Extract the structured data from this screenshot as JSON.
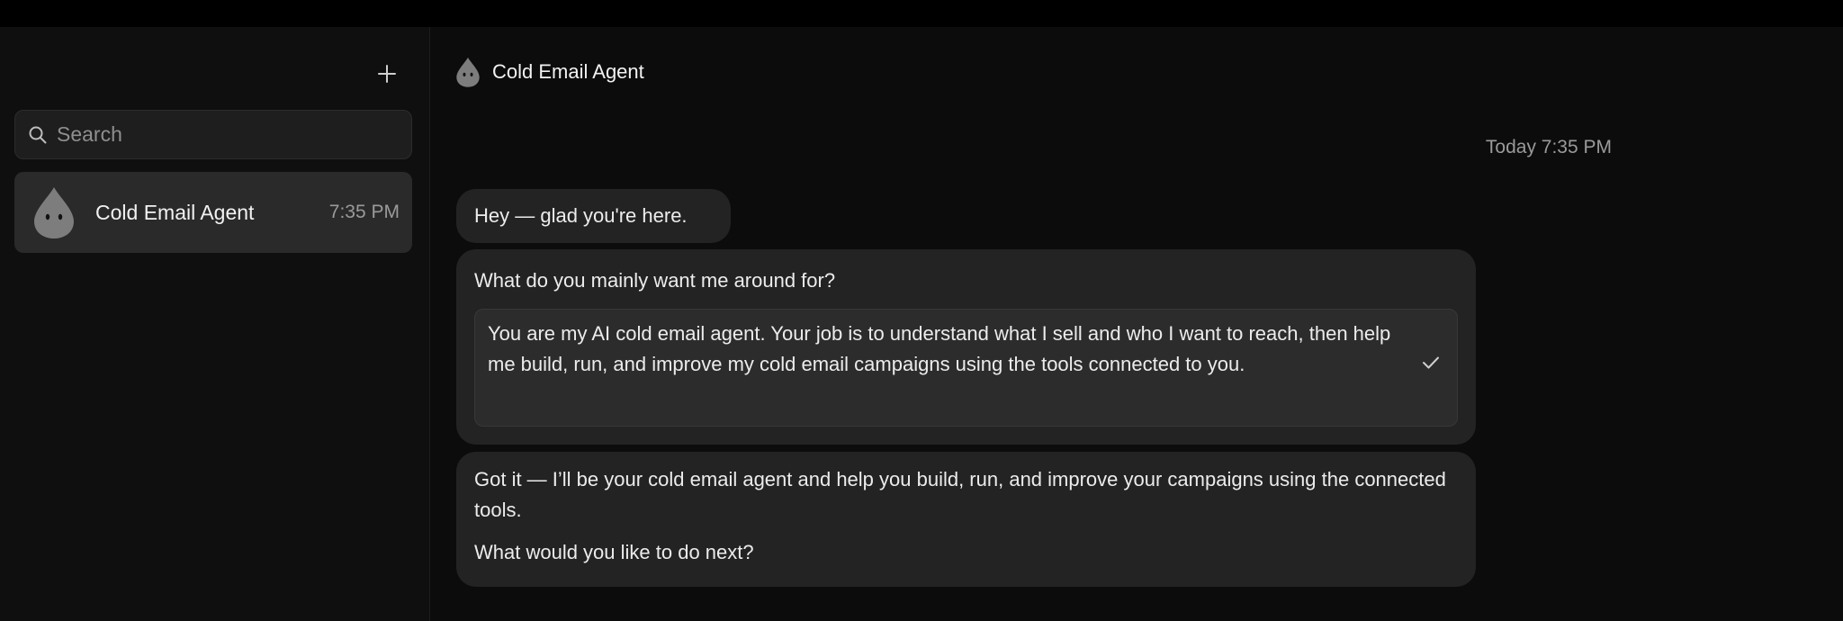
{
  "sidebar": {
    "new_chat_icon": "plus-icon",
    "search": {
      "placeholder": "Search",
      "value": ""
    },
    "chats": [
      {
        "name": "Cold Email Agent",
        "time": "7:35 PM",
        "avatar": "droplet-avatar"
      }
    ]
  },
  "header": {
    "title": "Cold Email Agent",
    "avatar": "droplet-avatar"
  },
  "conversation": {
    "timestamp": "Today 7:35 PM",
    "messages": [
      {
        "text": "Hey — glad you're here."
      },
      {
        "question": "What do you mainly want me around for?",
        "answer": "You are my AI cold email agent. Your job is to understand what I sell and who I want to reach, then help me build, run, and improve my cold email campaigns using the tools connected to you."
      },
      {
        "paragraph1": "Got it — I’ll be your cold email agent and help you build, run, and improve your campaigns using the connected tools.",
        "paragraph2": "What would you like to do next?"
      }
    ]
  },
  "colors": {
    "background": "#0c0c0c",
    "sidebar": "#0f0f0f",
    "bubble": "#232323",
    "selected_item": "#2a2a2a",
    "muted_text": "#9a9a9a"
  }
}
